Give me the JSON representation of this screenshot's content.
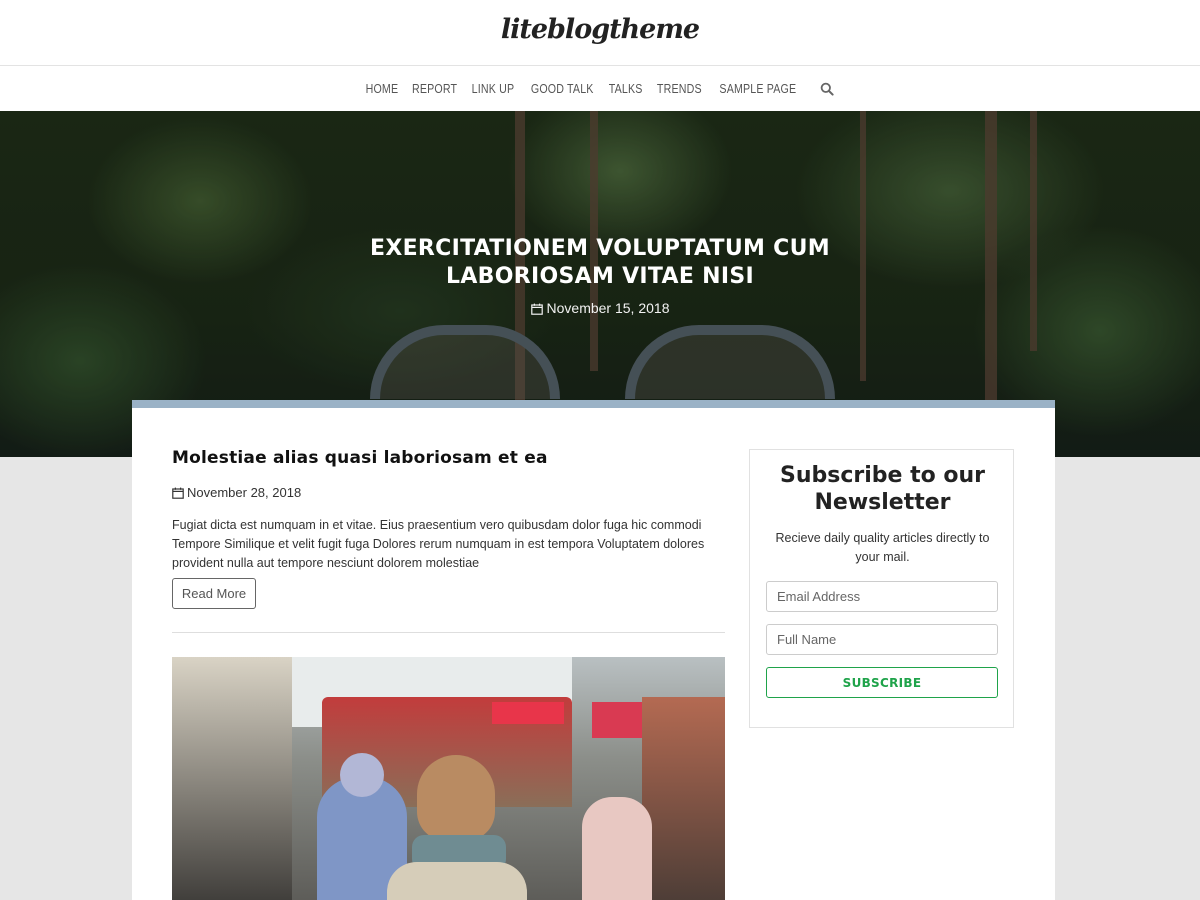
{
  "site": {
    "title": "liteblogtheme"
  },
  "nav": {
    "items": [
      "HOME",
      "REPORT",
      "LINK UP",
      "GOOD TALK",
      "TALKS",
      "TRENDS",
      "SAMPLE PAGE"
    ],
    "search_icon": "search-icon"
  },
  "hero": {
    "title": "EXERCITATIONEM VOLUPTATUM CUM LABORIOSAM VITAE NISI",
    "date": "November 15, 2018",
    "date_icon": "calendar-icon"
  },
  "post": {
    "title": "Molestiae alias quasi laboriosam et ea",
    "date": "November 28, 2018",
    "date_icon": "calendar-icon",
    "excerpt": "Fugiat dicta est numquam in et vitae. Eius praesentium vero quibusdam dolor fuga hic commodi Tempore Similique et velit fugit fuga Dolores rerum numquam in est tempora Voluptatem dolores provident nulla aut tempore nesciunt dolorem molestiae",
    "read_more_label": "Read More"
  },
  "newsletter": {
    "title": "Subscribe to our Newsletter",
    "description": "Recieve daily quality articles directly to your mail.",
    "email_placeholder": "Email Address",
    "name_placeholder": "Full Name",
    "submit_label": "SUBSCRIBE"
  },
  "colors": {
    "accent_green": "#1fa34a",
    "box_top_border": "#9ab2c6",
    "page_background": "#e6e6e6"
  }
}
